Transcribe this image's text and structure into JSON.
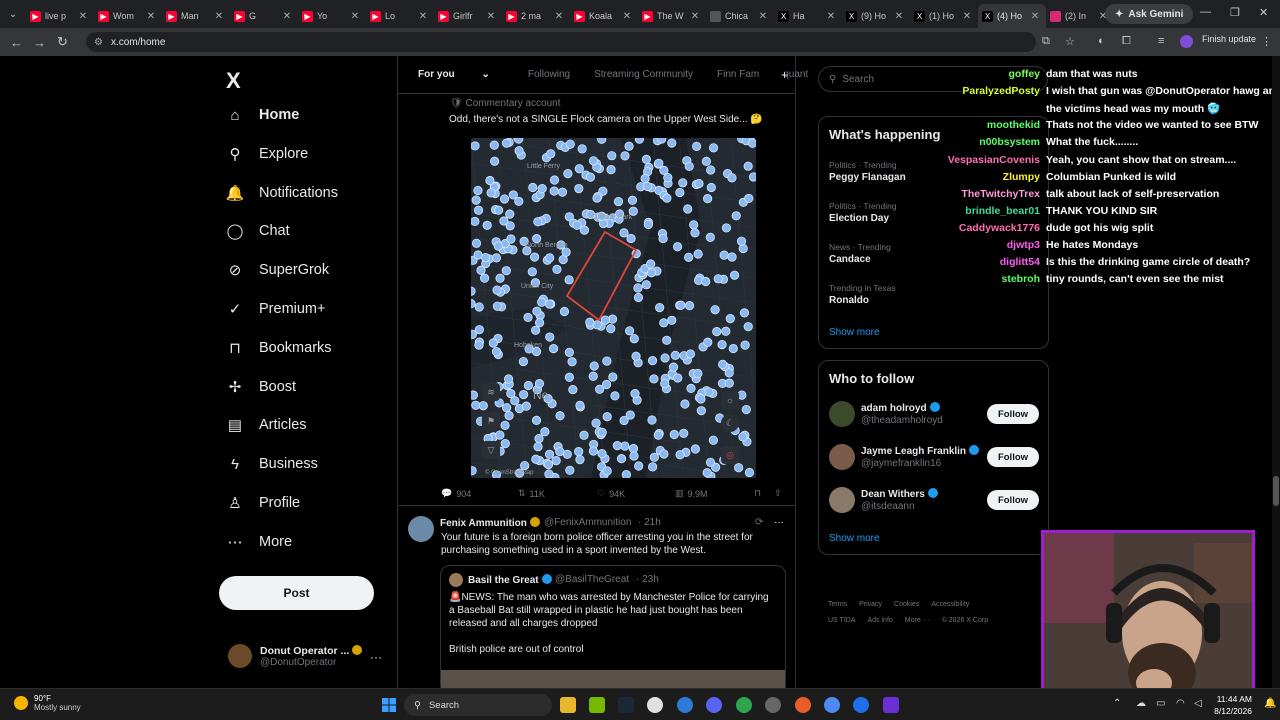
{
  "browser": {
    "tabs": [
      {
        "label": "live p",
        "fav_color": "#ff0033",
        "fav": "yt"
      },
      {
        "label": "Wom",
        "fav_color": "#ff0033",
        "fav": "yt"
      },
      {
        "label": "Man",
        "fav_color": "#ff0033",
        "fav": "yt"
      },
      {
        "label": "G",
        "fav_color": "#ff0033",
        "fav": "yt"
      },
      {
        "label": "Yo",
        "fav_color": "#ff0033",
        "fav": "yt"
      },
      {
        "label": "Lo",
        "fav_color": "#ff0033",
        "fav": "yt"
      },
      {
        "label": "Girlfr",
        "fav_color": "#ff0033",
        "fav": "yt"
      },
      {
        "label": "2 ma",
        "fav_color": "#ff0033",
        "fav": "yt"
      },
      {
        "label": "Koala",
        "fav_color": "#ff0033",
        "fav": "yt"
      },
      {
        "label": "The W",
        "fav_color": "#ff0033",
        "fav": "yt"
      },
      {
        "label": "Chica",
        "fav_color": "#555555",
        "fav": "web"
      },
      {
        "label": "Ha",
        "fav_color": "#000000",
        "fav": "x"
      },
      {
        "label": "(9) Ho",
        "fav_color": "#000000",
        "fav": "x"
      },
      {
        "label": "(1) Ho",
        "fav_color": "#000000",
        "fav": "x"
      },
      {
        "label": "(4) Ho",
        "fav_color": "#000000",
        "fav": "x",
        "active": true
      },
      {
        "label": "(2) In",
        "fav_color": "#d62976",
        "fav": "ig"
      }
    ],
    "new_tab": "+",
    "ask_gemini": "Ask Gemini",
    "url": "x.com/home",
    "finish_update": "Finish update"
  },
  "sidebar": {
    "logo": "X",
    "items": [
      {
        "label": "Home",
        "icon": "home-icon",
        "glyph": "⌂",
        "bold": true
      },
      {
        "label": "Explore",
        "icon": "search-icon",
        "glyph": "⚲"
      },
      {
        "label": "Notifications",
        "icon": "bell-icon",
        "glyph": "🔔"
      },
      {
        "label": "Chat",
        "icon": "chat-icon",
        "glyph": "◯"
      },
      {
        "label": "SuperGrok",
        "icon": "grok-icon",
        "glyph": "⊘"
      },
      {
        "label": "Premium+",
        "icon": "premium-icon",
        "glyph": "✓"
      },
      {
        "label": "Bookmarks",
        "icon": "bookmark-icon",
        "glyph": "⊓"
      },
      {
        "label": "Boost",
        "icon": "boost-icon",
        "glyph": "✢"
      },
      {
        "label": "Articles",
        "icon": "articles-icon",
        "glyph": "▤"
      },
      {
        "label": "Business",
        "icon": "lightning-icon",
        "glyph": "ϟ"
      },
      {
        "label": "Profile",
        "icon": "profile-icon",
        "glyph": "♙"
      },
      {
        "label": "More",
        "icon": "more-icon",
        "glyph": "⋯"
      }
    ],
    "post_label": "Post",
    "account": {
      "name": "Donut Operator ...",
      "handle": "@DonutOperator"
    }
  },
  "timeline": {
    "tabs": [
      "For you",
      "Following",
      "Streaming Community",
      "Finn Fam",
      "quant"
    ],
    "post1": {
      "context": "Commentary account",
      "text": "Odd, there's not a SINGLE Flock camera on the Upper West Side... 🤔",
      "map_labels": [
        "Little Ferry",
        "Cliffside Park",
        "North Bergen",
        "Union City",
        "Hoboken",
        "Ne",
        "© OpenStreetMap"
      ],
      "replies": "904",
      "reposts": "11K",
      "likes": "94K",
      "views": "9.9M"
    },
    "post2": {
      "name": "Fenix Ammunition",
      "handle": "@FenixAmmunition",
      "time": "· 21h",
      "text_line1": "Your future is a foreign born police officer arresting you in the street for",
      "text_line2": "purchasing something used in a sport invented by the West.",
      "quote": {
        "name": "Basil the Great",
        "handle": "@BasilTheGreat",
        "time": "· 23h",
        "line1": "🚨NEWS: The man who was arrested by Manchester Police for carrying",
        "line2": "a Baseball Bat still wrapped in plastic he had just bought has been",
        "line3": "released and all charges dropped",
        "line4": "British police are out of control"
      }
    }
  },
  "right": {
    "search_placeholder": "Search",
    "whats_happening": {
      "title": "What's happening",
      "trends": [
        {
          "cat": "Politics · Trending",
          "name": "Peggy Flanagan"
        },
        {
          "cat": "Politics · Trending",
          "name": "Election Day"
        },
        {
          "cat": "News · Trending",
          "name": "Candace"
        },
        {
          "cat": "Trending in Texas",
          "name": "Ronaldo"
        }
      ],
      "show_more": "Show more"
    },
    "who_to_follow": {
      "title": "Who to follow",
      "accounts": [
        {
          "name": "adam holroyd",
          "handle": "@theadamholroyd",
          "color": "#3b4a2a"
        },
        {
          "name": "Jayme Leagh Franklin",
          "handle": "@jaymefranklin16",
          "color": "#7a5a48"
        },
        {
          "name": "Dean Withers",
          "handle": "@itsdeaann",
          "color": "#8a7868"
        }
      ],
      "follow_label": "Follow",
      "show_more": "Show more"
    },
    "footer": [
      "Terms",
      "Privacy",
      "Cookies",
      "Accessibility",
      "US TIDA",
      "Ads info",
      "More ···",
      "© 2026 X Corp."
    ]
  },
  "chat": [
    {
      "user": "goffey",
      "color": "#7dff5a",
      "msg": "dam that was nuts"
    },
    {
      "user": "ParalyzedPosty",
      "color": "#d4ff3a",
      "msg": "I wish that gun was @DonutOperator hawg and"
    },
    {
      "user": "",
      "color": "#ffffff",
      "msg": "the victims head was my mouth 🥶"
    },
    {
      "user": "moothekid",
      "color": "#5dff66",
      "msg": "Thats not the video we wanted to see BTW"
    },
    {
      "user": "n00bsystem",
      "color": "#5dff66",
      "msg": "What the fuck........"
    },
    {
      "user": "VespasianCovenis",
      "color": "#ff6fb1",
      "msg": "Yeah, you cant show that on stream...."
    },
    {
      "user": "Zlumpy",
      "color": "#ffee33",
      "msg": "Columbian Punked is wild"
    },
    {
      "user": "TheTwitchyTrex",
      "color": "#ff9bd6",
      "msg": "talk about lack of self-preservation"
    },
    {
      "user": "brindle_bear01",
      "color": "#3ddc97",
      "msg": "THANK YOU KIND SIR"
    },
    {
      "user": "Caddywack1776",
      "color": "#ff6fb1",
      "msg": "dude got his wig split"
    },
    {
      "user": "djwtp3",
      "color": "#ff5cf0",
      "msg": "He hates Mondays"
    },
    {
      "user": "diglitt54",
      "color": "#ff5cf0",
      "msg": "Is this the drinking game circle of death?"
    },
    {
      "user": "stebroh",
      "color": "#5dff66",
      "msg": "tiny rounds, can't even see the mist"
    }
  ],
  "taskbar": {
    "temp": "90°F",
    "weather": "Mostly sunny",
    "search": "Search",
    "time": "11:44 AM",
    "date": "8/12/2026"
  }
}
